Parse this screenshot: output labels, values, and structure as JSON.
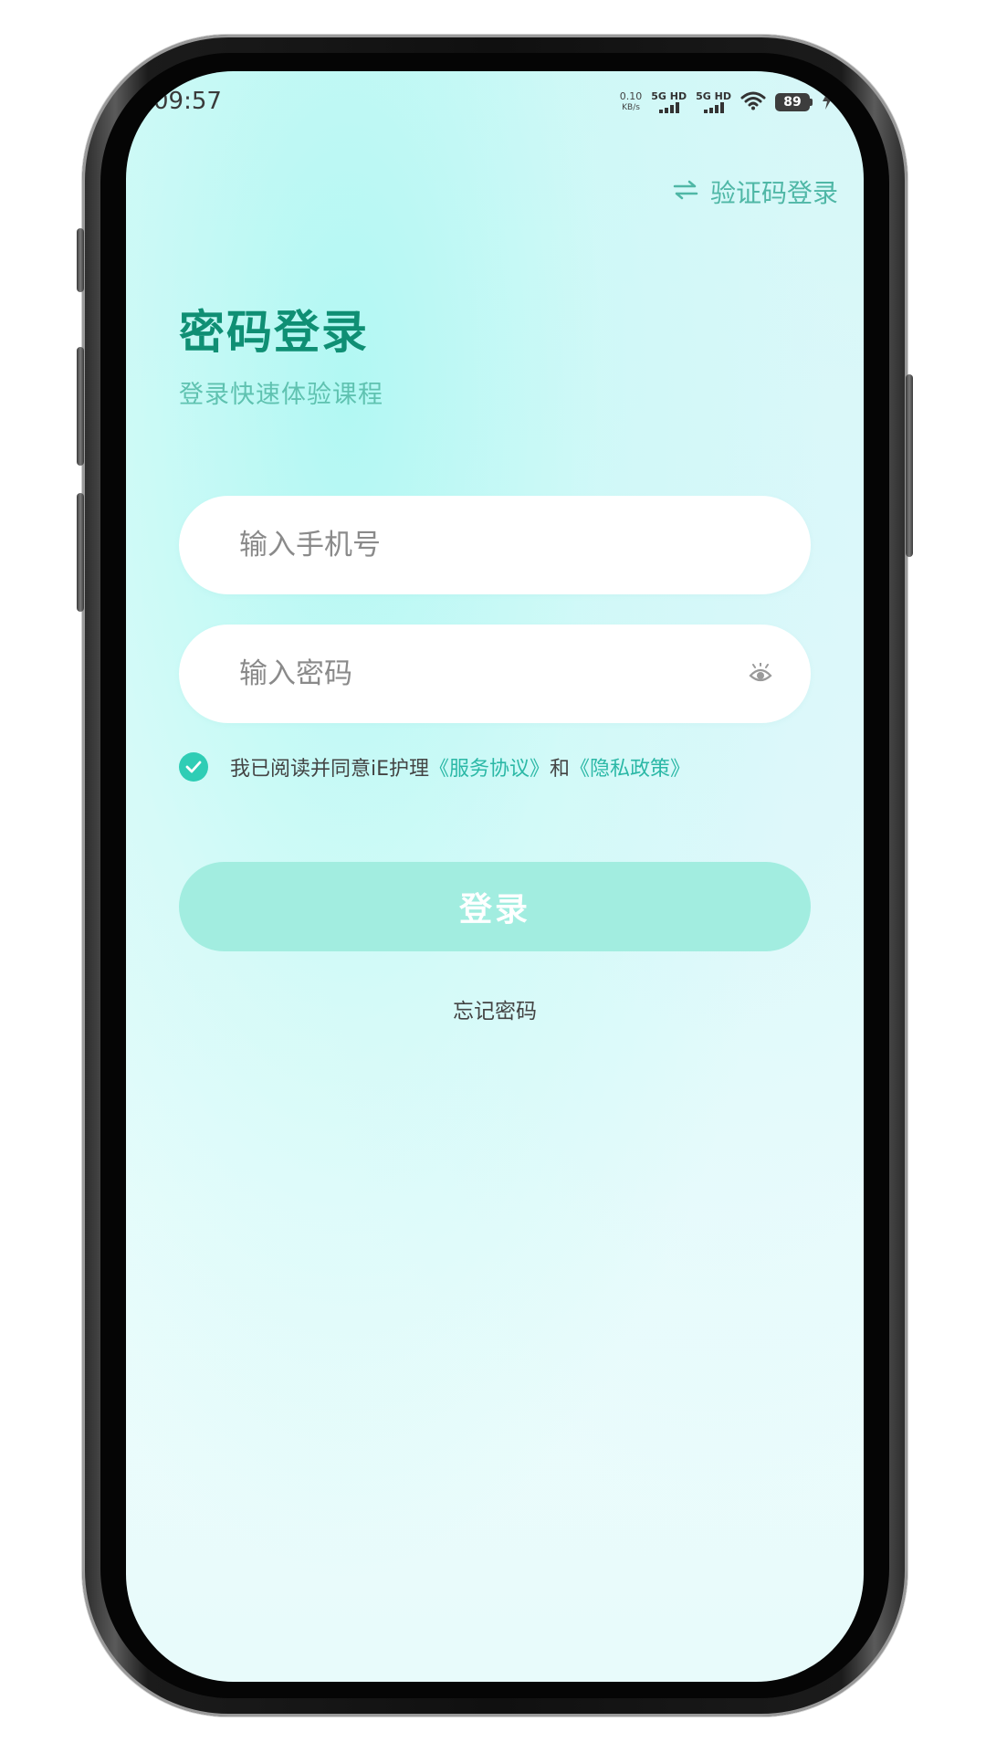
{
  "status_bar": {
    "time": "09:57",
    "net_speed_value": "0.10",
    "net_speed_unit": "KB/s",
    "sim1_label": "5G HD",
    "sim2_label": "5G HD",
    "battery": "89",
    "icons": [
      "wifi-icon",
      "signal-icon",
      "battery-icon",
      "charging-icon"
    ]
  },
  "header": {
    "switch_login_label": "验证码登录",
    "switch_icon": "swap-arrows-icon"
  },
  "page": {
    "title": "密码登录",
    "subtitle": "登录快速体验课程"
  },
  "form": {
    "phone_placeholder": "输入手机号",
    "phone_value": "",
    "password_placeholder": "输入密码",
    "password_value": "",
    "password_visibility_icon": "eye-icon"
  },
  "agreement": {
    "checked": true,
    "prefix": "我已阅读并同意iE护理",
    "terms_link": "《服务协议》",
    "connector": "和",
    "privacy_link": "《隐私政策》"
  },
  "actions": {
    "login_label": "登录",
    "forgot_password_label": "忘记密码"
  },
  "colors": {
    "accent": "#0f8f74",
    "link": "#2bb8a6",
    "button_disabled": "#a2ede0",
    "check": "#2fcdb5"
  }
}
